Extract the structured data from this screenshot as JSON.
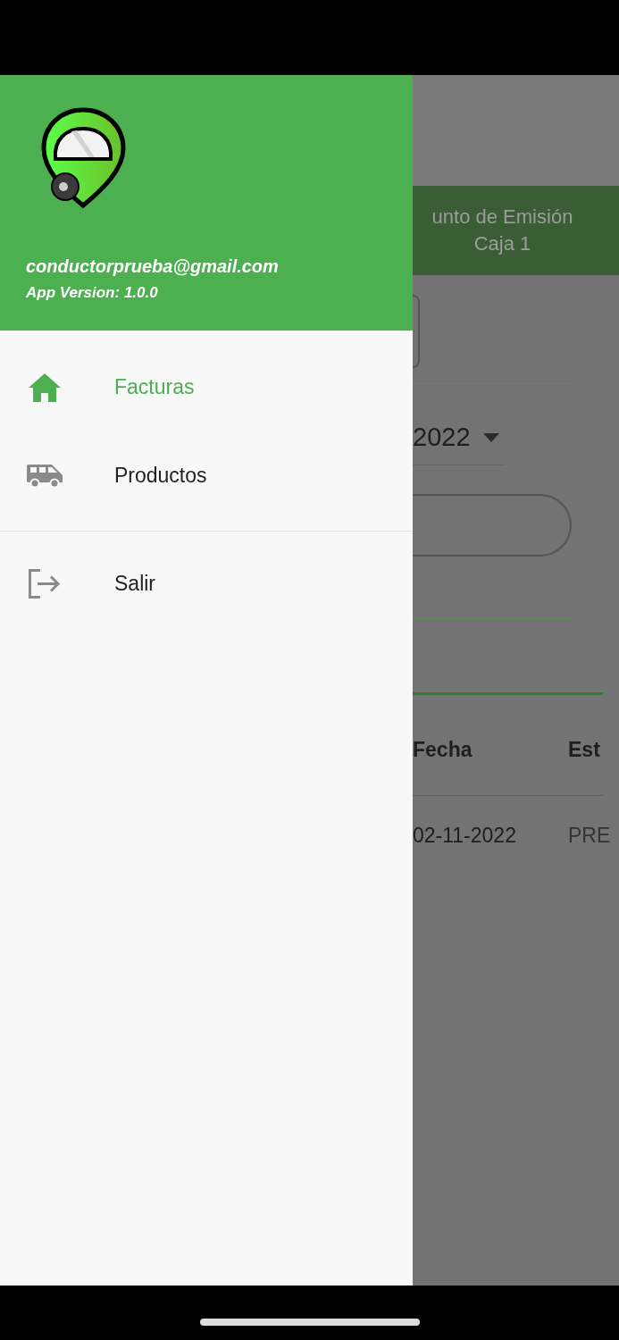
{
  "drawer": {
    "email": "conductorprueba@gmail.com",
    "app_version": "App Version: 1.0.0",
    "items": [
      {
        "label": "Facturas",
        "kind": "home",
        "selected": true
      },
      {
        "label": "Productos",
        "kind": "van",
        "selected": false
      }
    ],
    "footer_items": [
      {
        "label": "Salir",
        "kind": "logout",
        "selected": false
      }
    ]
  },
  "background_page": {
    "banner": [
      "unto de Emisión",
      "Caja 1"
    ],
    "dropdown_value": "2022",
    "table": {
      "columns": [
        "Fecha",
        "Est"
      ],
      "rows": [
        [
          "02-11-2022",
          "PRE"
        ]
      ]
    }
  }
}
